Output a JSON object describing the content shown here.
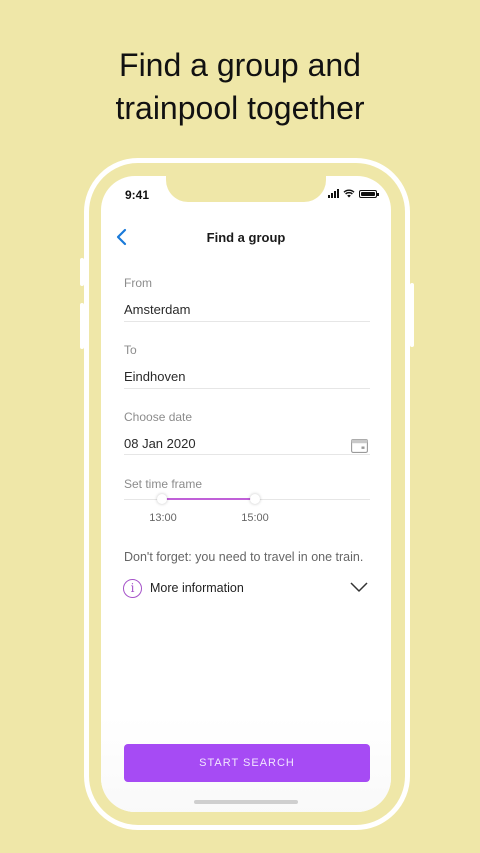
{
  "headline": {
    "line1": "Find a group and",
    "line2": "trainpool together"
  },
  "status_bar": {
    "time": "9:41"
  },
  "nav": {
    "title": "Find a group",
    "back_icon": "chevron-left-icon"
  },
  "form": {
    "from": {
      "label": "From",
      "value": "Amsterdam"
    },
    "to": {
      "label": "To",
      "value": "Eindhoven"
    },
    "date": {
      "label": "Choose date",
      "value": "08 Jan 2020",
      "icon": "calendar-icon"
    },
    "time_frame": {
      "label": "Set time frame",
      "start": "13:00",
      "end": "15:00"
    }
  },
  "note": "Don't forget: you need to travel in one train.",
  "more_info": {
    "label": "More information",
    "icon": "info-icon"
  },
  "cta": {
    "label": "START SEARCH"
  },
  "colors": {
    "background": "#efe7a8",
    "accent": "#a64bf4",
    "back_arrow": "#1a7ad9"
  }
}
